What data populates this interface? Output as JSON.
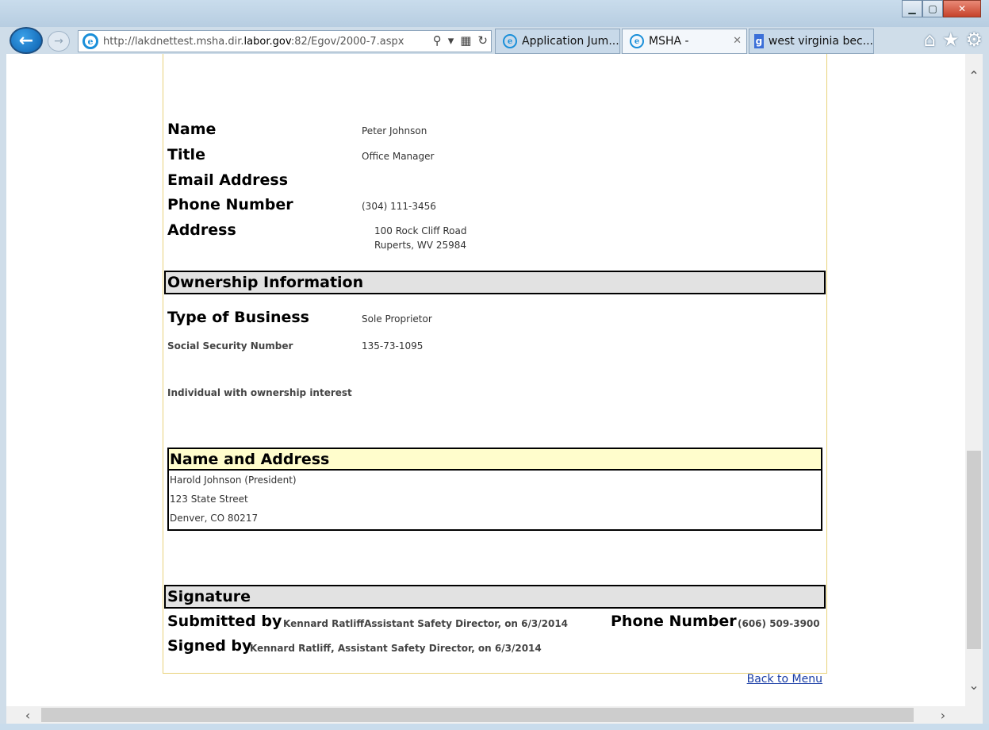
{
  "browser": {
    "url_prefix": "http://lakdnettest.msha.dir.",
    "url_domain": "labor.gov",
    "url_suffix": ":82/Egov/2000-7.aspx",
    "tabs": [
      {
        "label": "Application Jum..."
      },
      {
        "label": "MSHA -"
      },
      {
        "label": "west virginia bec..."
      }
    ]
  },
  "contact": {
    "name_label": "Name",
    "name_value": "Peter Johnson",
    "title_label": "Title",
    "title_value": "Office Manager",
    "email_label": "Email Address",
    "email_value": "",
    "phone_label": "Phone Number",
    "phone_value": "(304) 111-3456",
    "address_label": "Address",
    "address_line1": "100 Rock Cliff Road",
    "address_line2": "Ruperts, WV 25984"
  },
  "ownership": {
    "header": "Ownership Information",
    "type_label": "Type of Business",
    "type_value": "Sole Proprietor",
    "ssn_label": "Social Security Number",
    "ssn_value": "135-73-1095",
    "individual_label": "Individual with ownership interest",
    "name_address_header": "Name and Address",
    "owner_lines": [
      "Harold Johnson (President)",
      "123 State Street",
      "Denver, CO 80217"
    ]
  },
  "signature": {
    "header": "Signature",
    "submitted_label": "Submitted by",
    "submitted_value": "Kennard RatliffAssistant Safety Director, on 6/3/2014",
    "phone_label": "Phone Number",
    "phone_value": "(606) 509-3900",
    "signed_label": "Signed by",
    "signed_value": "Kennard Ratliff, Assistant Safety Director, on 6/3/2014"
  },
  "back_to_menu": "Back to Menu"
}
